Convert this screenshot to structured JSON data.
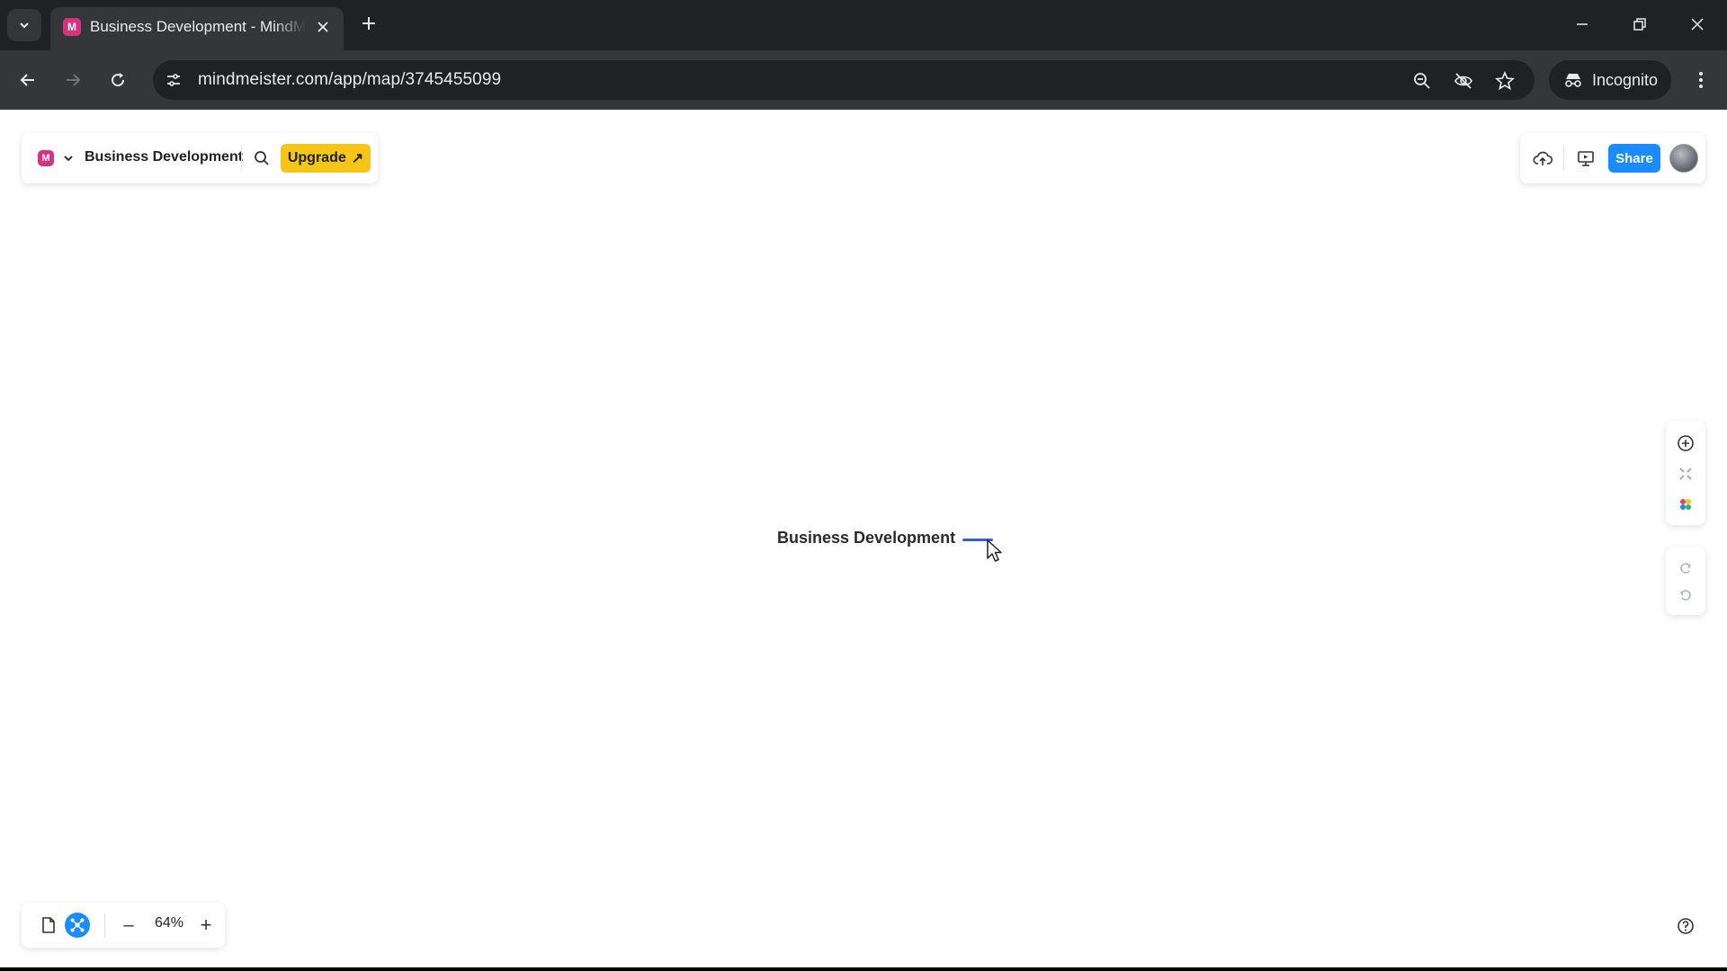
{
  "browser": {
    "tab_title": "Business Development - MindMeister",
    "tab_favicon_letter": "M",
    "url": "mindmeister.com/app/map/3745455099",
    "incognito_label": "Incognito"
  },
  "app": {
    "logo_letter": "M",
    "map_title": "Business Development",
    "upgrade_label": "Upgrade",
    "upgrade_arrow": "↗",
    "share_label": "Share"
  },
  "canvas": {
    "root_node_text": "Business Development"
  },
  "zoom": {
    "level": "64%",
    "minus": "–",
    "plus": "+"
  },
  "colors": {
    "brand": "#d6337f",
    "accent": "#1a8cff",
    "upgrade": "#f5c518",
    "connector": "#3b5bdb"
  },
  "icons": {
    "right_rail": [
      "add-circle-icon",
      "collapse-icon",
      "style-palette-icon",
      "redo-icon",
      "undo-icon"
    ],
    "top_right": [
      "cloud-upload-icon",
      "present-icon"
    ],
    "help": "help-icon"
  }
}
